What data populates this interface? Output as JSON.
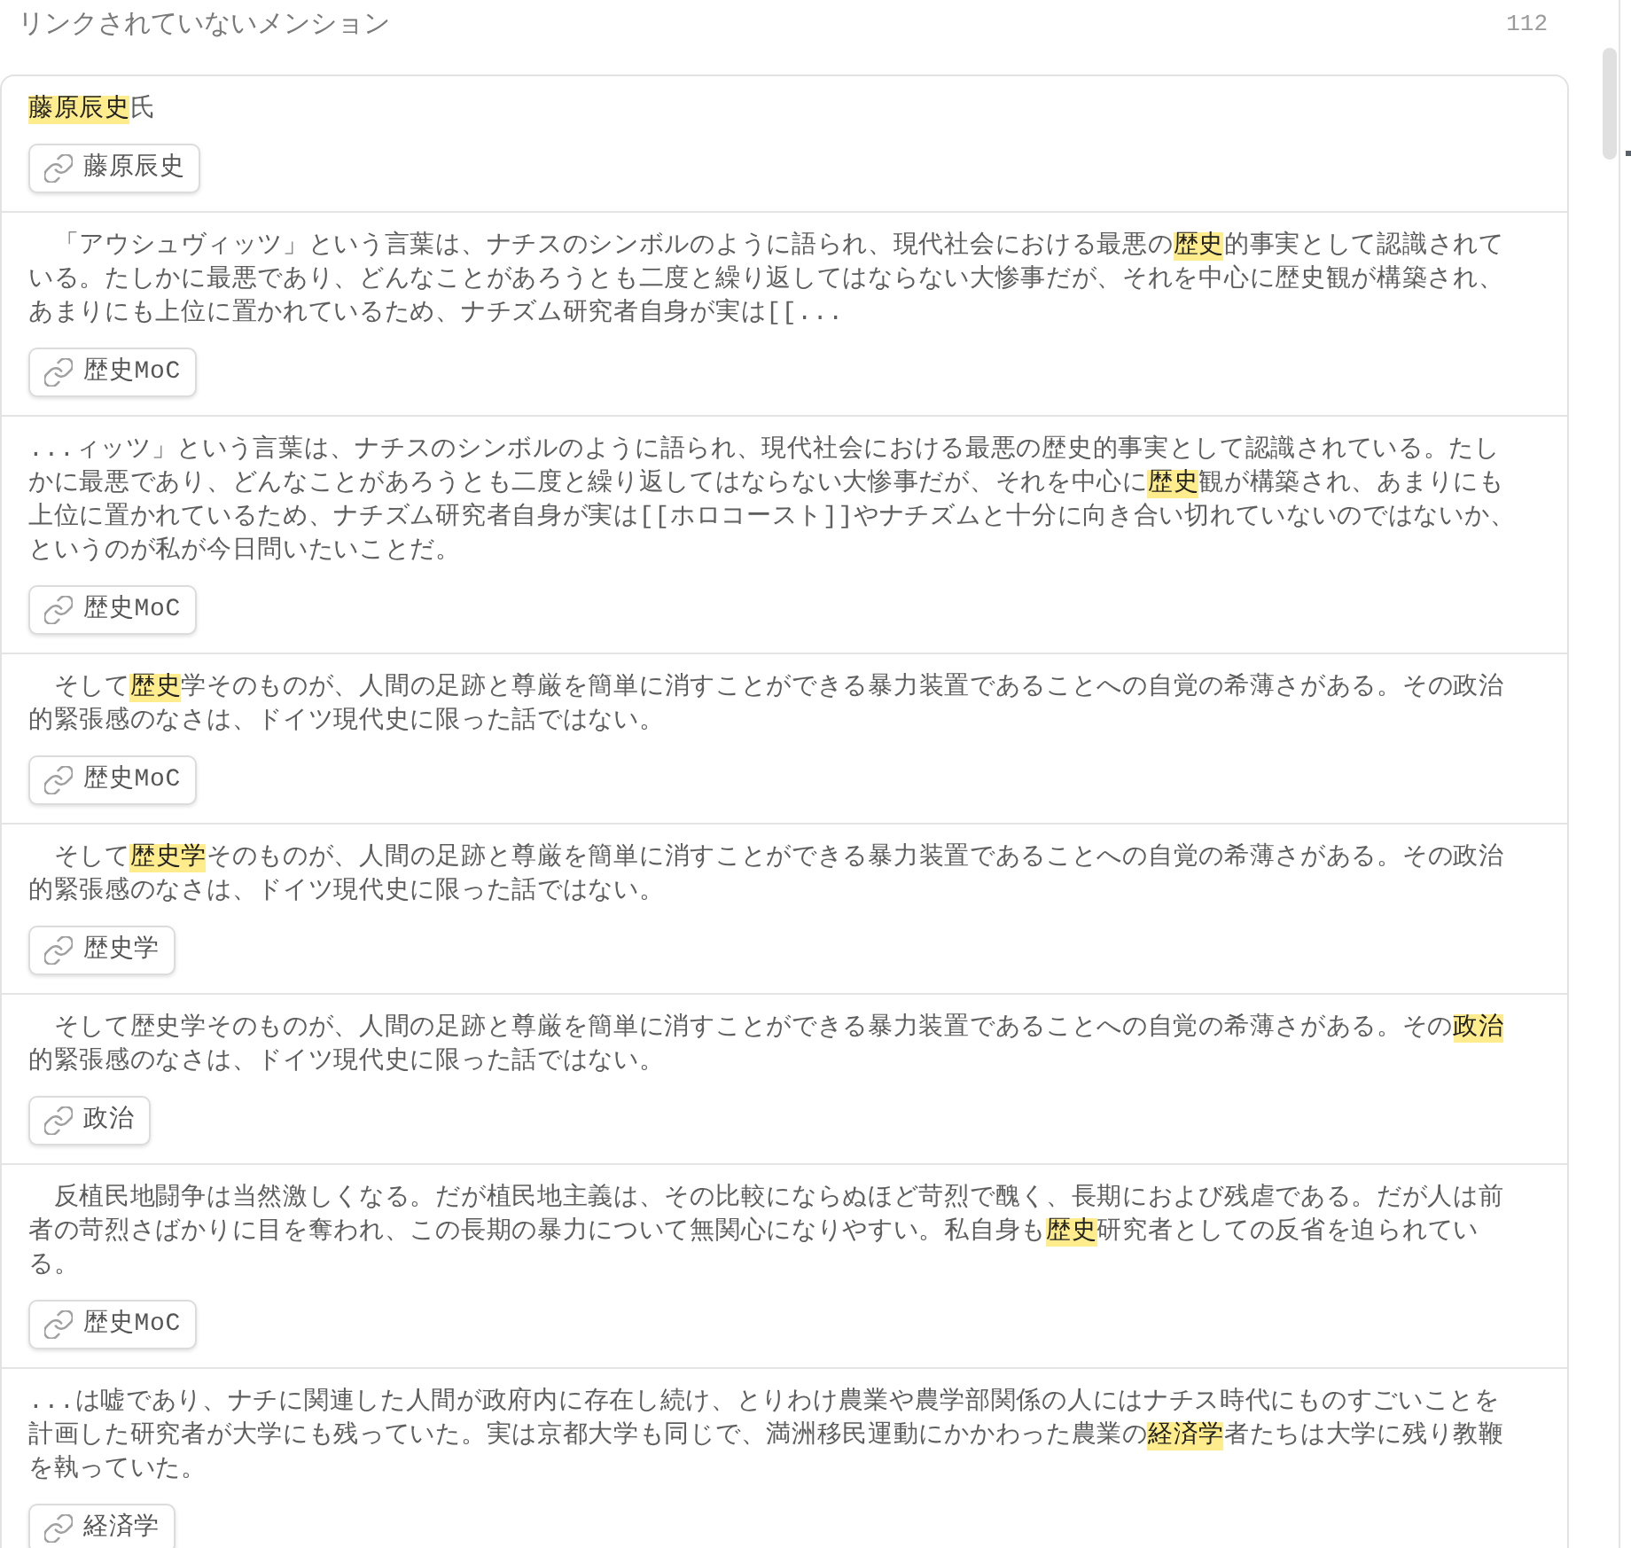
{
  "panel": {
    "title": "リンクされていないメンション",
    "count": "112"
  },
  "mentions": [
    {
      "segments": [
        {
          "text": "藤原辰史",
          "highlighted": true
        },
        {
          "text": "氏",
          "highlighted": false
        }
      ],
      "link_button": "藤原辰史"
    },
    {
      "segments": [
        {
          "text": "　「アウシュヴィッツ」という言葉は、ナチスのシンボルのように語られ、現代社会における最悪の",
          "highlighted": false
        },
        {
          "text": "歴史",
          "highlighted": true
        },
        {
          "text": "的事実として認識されている。たしかに最悪であり、どんなことがあろうとも二度と繰り返してはならない大惨事だが、それを中心に歴史観が構築され、あまりにも上位に置かれているため、ナチズム研究者自身が実は[[...",
          "highlighted": false
        }
      ],
      "link_button": "歴史MoC"
    },
    {
      "segments": [
        {
          "text": "...ィッツ」という言葉は、ナチスのシンボルのように語られ、現代社会における最悪の歴史的事実として認識されている。たしかに最悪であり、どんなことがあろうとも二度と繰り返してはならない大惨事だが、それを中心に",
          "highlighted": false
        },
        {
          "text": "歴史",
          "highlighted": true
        },
        {
          "text": "観が構築され、あまりにも上位に置かれているため、ナチズム研究者自身が実は[[ホロコースト]]やナチズムと十分に向き合い切れていないのではないか、というのが私が今日問いたいことだ。",
          "highlighted": false
        }
      ],
      "link_button": "歴史MoC"
    },
    {
      "segments": [
        {
          "text": "　そして",
          "highlighted": false
        },
        {
          "text": "歴史",
          "highlighted": true
        },
        {
          "text": "学そのものが、人間の足跡と尊厳を簡単に消すことができる暴力装置であることへの自覚の希薄さがある。その政治的緊張感のなさは、ドイツ現代史に限った話ではない。",
          "highlighted": false
        }
      ],
      "link_button": "歴史MoC"
    },
    {
      "segments": [
        {
          "text": "　そして",
          "highlighted": false
        },
        {
          "text": "歴史学",
          "highlighted": true
        },
        {
          "text": "そのものが、人間の足跡と尊厳を簡単に消すことができる暴力装置であることへの自覚の希薄さがある。その政治的緊張感のなさは、ドイツ現代史に限った話ではない。",
          "highlighted": false
        }
      ],
      "link_button": "歴史学"
    },
    {
      "segments": [
        {
          "text": "　そして歴史学そのものが、人間の足跡と尊厳を簡単に消すことができる暴力装置であることへの自覚の希薄さがある。その",
          "highlighted": false
        },
        {
          "text": "政治",
          "highlighted": true
        },
        {
          "text": "的緊張感のなさは、ドイツ現代史に限った話ではない。",
          "highlighted": false
        }
      ],
      "link_button": "政治"
    },
    {
      "segments": [
        {
          "text": "　反植民地闘争は当然激しくなる。だが植民地主義は、その比較にならぬほど苛烈で醜く、長期におよび残虐である。だが人は前者の苛烈さばかりに目を奪われ、この長期の暴力について無関心になりやすい。私自身も",
          "highlighted": false
        },
        {
          "text": "歴史",
          "highlighted": true
        },
        {
          "text": "研究者としての反省を迫られている。",
          "highlighted": false
        }
      ],
      "link_button": "歴史MoC"
    },
    {
      "segments": [
        {
          "text": "...は嘘であり、ナチに関連した人間が政府内に存在し続け、とりわけ農業や農学部関係の人にはナチス時代にものすごいことを計画した研究者が大学にも残っていた。実は京都大学も同じで、満洲移民運動にかかわった農業の",
          "highlighted": false
        },
        {
          "text": "経済学",
          "highlighted": true
        },
        {
          "text": "者たちは大学に残り教鞭を執っていた。",
          "highlighted": false
        }
      ],
      "link_button": "経済学"
    }
  ]
}
